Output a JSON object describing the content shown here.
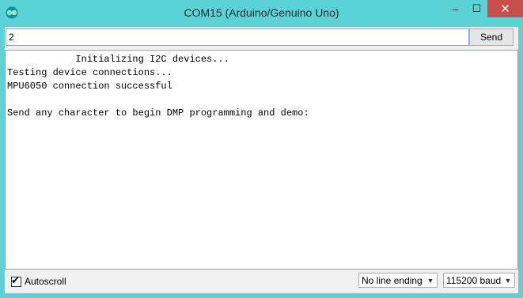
{
  "window": {
    "title": "COM15 (Arduino/Genuino Uno)",
    "controls": {
      "minimize": "–",
      "maximize": "☐",
      "close": "✕"
    }
  },
  "app_icon": "arduino-icon",
  "serial_input": {
    "value": "2",
    "send_label": "Send"
  },
  "output": {
    "lines": [
      "            Initializing I2C devices...",
      "Testing device connections...",
      "MPU6050 connection successful",
      "",
      "Send any character to begin DMP programming and demo:"
    ]
  },
  "bottom": {
    "autoscroll_label": "Autoscroll",
    "autoscroll_checked": true,
    "line_ending": "No line ending",
    "baud_rate": "115200 baud"
  },
  "colors": {
    "titlebar": "#5ad3d6",
    "close_button": "#c7504d",
    "arduino_teal": "#00979c"
  }
}
